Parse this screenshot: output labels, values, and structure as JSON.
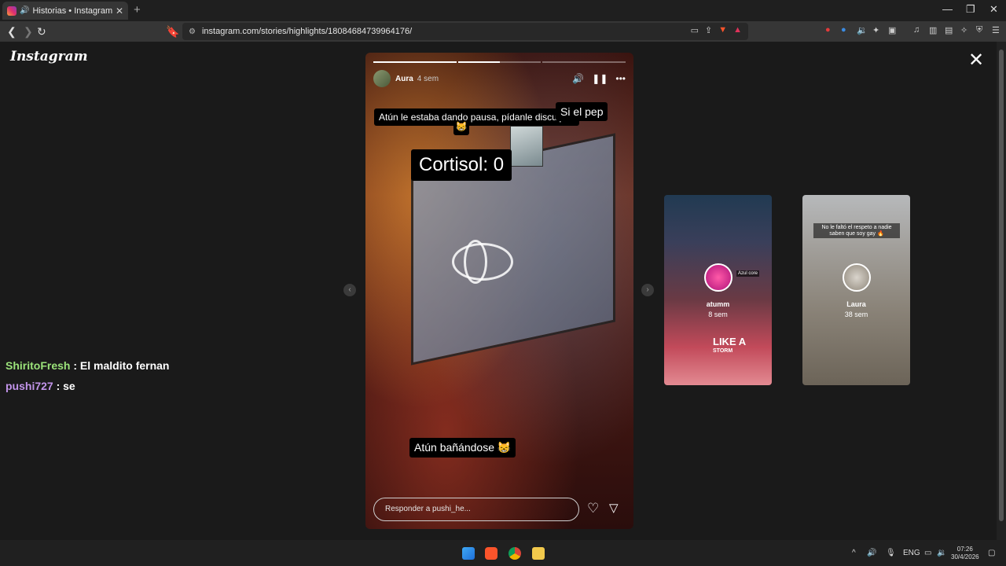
{
  "browser": {
    "tab_title": "Historias • Instagram",
    "url": "instagram.com/stories/highlights/18084684739964176/",
    "colors": {
      "tab_bg": "#363636",
      "toolbar_bg": "#363636"
    }
  },
  "page": {
    "logo": "Instagram",
    "story": {
      "username": "Aura",
      "time": "4 sem",
      "progress": [
        1.0,
        0.5,
        0.0
      ],
      "captions": {
        "top": "Atún le estaba dando pausa, pídanle disculpas",
        "top_right": "Si el pep",
        "center": "Cortisol: 0",
        "bottom": "Atún bañándose 😸"
      },
      "reply_placeholder": "Responder a pushi_he..."
    },
    "previews": [
      {
        "name": "atumm",
        "time": "8 sem",
        "sticker_main": "LIKE A",
        "sticker_sub": "STORM",
        "tag": "Azul core"
      },
      {
        "name": "Laura",
        "time": "38 sem",
        "caption": "No le faltó el respeto a nadie saben que soy gay 🔥"
      }
    ],
    "chat": [
      {
        "user": "ShiritoFresh",
        "message": " : El maldito fernan"
      },
      {
        "user": "pushi727",
        "message": " : se"
      }
    ]
  },
  "taskbar": {
    "language": "ENG",
    "time": "07:26",
    "date": "30/4/2026"
  }
}
